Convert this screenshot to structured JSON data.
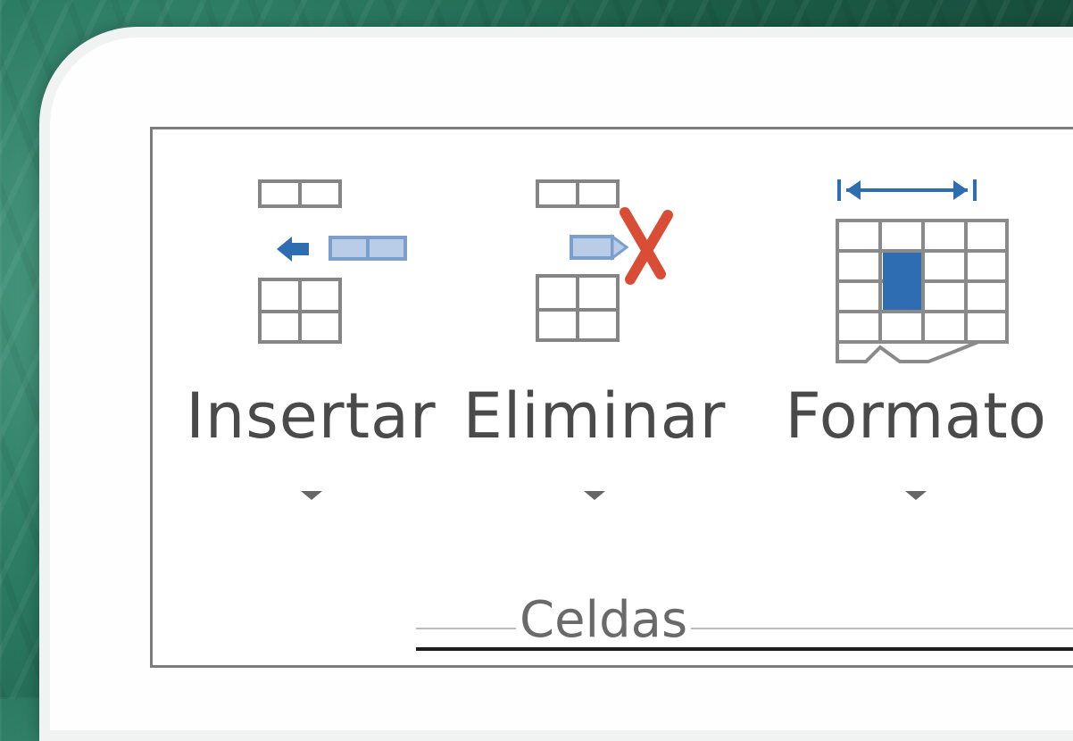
{
  "ribbon_group": {
    "label": "Celdas",
    "commands": [
      {
        "label": "Insertar",
        "icon": "insert-cells-icon",
        "dropdown": "chevron-down-icon"
      },
      {
        "label": "Eliminar",
        "icon": "delete-cells-icon",
        "dropdown": "chevron-down-icon"
      },
      {
        "label": "Formato",
        "icon": "format-cells-icon",
        "dropdown": "chevron-down-icon"
      }
    ]
  },
  "colors": {
    "accent_blue": "#2f6db2",
    "delete_red": "#d94c35",
    "text_gray": "#4a4a4a",
    "group_border": "#7c7c7c"
  }
}
